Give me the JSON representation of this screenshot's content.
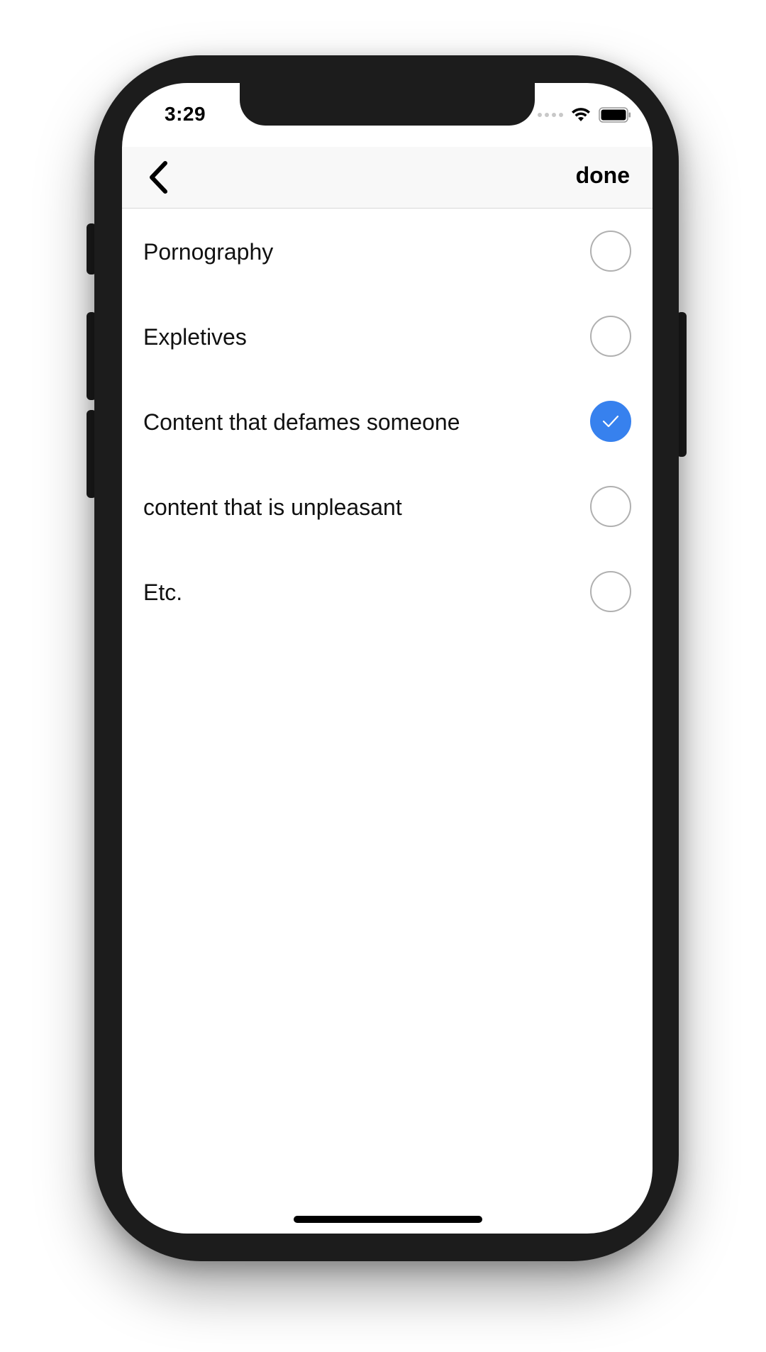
{
  "status_bar": {
    "time": "3:29"
  },
  "navbar": {
    "back_icon": "chevron-left-icon",
    "done_label": "done"
  },
  "options": [
    {
      "label": "Pornography",
      "checked": false
    },
    {
      "label": "Expletives",
      "checked": false
    },
    {
      "label": "Content that defames someone",
      "checked": true
    },
    {
      "label": "content that is unpleasant",
      "checked": false
    },
    {
      "label": "Etc.",
      "checked": false
    }
  ],
  "colors": {
    "accent": "#3781ee",
    "radio_border": "#b0b0b0",
    "navbar_bg": "#f8f8f8",
    "device_frame": "#1c1c1c"
  }
}
